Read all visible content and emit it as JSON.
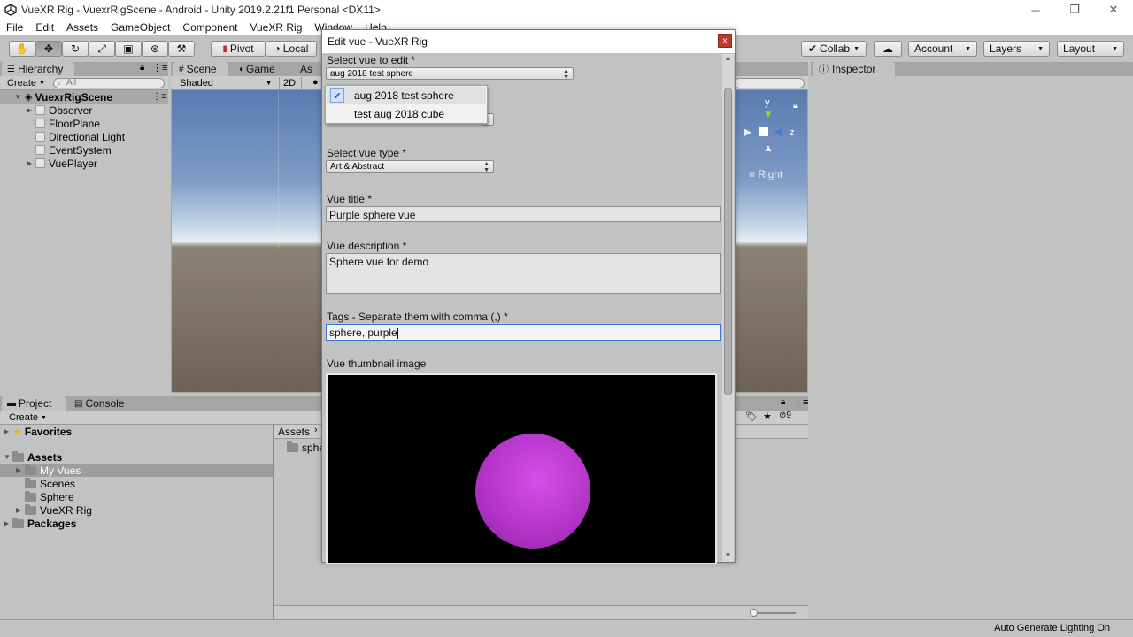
{
  "window": {
    "title": "VueXR Rig - VuexrRigScene - Android - Unity 2019.2.21f1 Personal <DX11>",
    "minimize": "─",
    "maximize": "❐",
    "close": "✕"
  },
  "menubar": [
    "File",
    "Edit",
    "Assets",
    "GameObject",
    "Component",
    "VueXR Rig",
    "Window",
    "Help"
  ],
  "toolbar": {
    "pivot": "Pivot",
    "local": "Local",
    "collab": "Collab",
    "account": "Account",
    "layers": "Layers",
    "layout": "Layout"
  },
  "hierarchy": {
    "tab": "Hierarchy",
    "create": "Create",
    "search_placeholder": "All",
    "scene": "VuexrRigScene",
    "items": [
      "Observer",
      "FloorPlane",
      "Directional Light",
      "EventSystem",
      "VuePlayer"
    ]
  },
  "scene": {
    "tab_scene": "Scene",
    "tab_game": "Game",
    "tab_asset": "As",
    "shaded": "Shaded",
    "mode_2d": "2D",
    "gizmo_y": "y",
    "gizmo_z": "z",
    "gizmo_view": "Right"
  },
  "inspector": {
    "tab": "Inspector"
  },
  "project": {
    "tab_project": "Project",
    "tab_console": "Console",
    "create": "Create",
    "favorites": "Favorites",
    "assets": "Assets",
    "asset_items": [
      "My Vues",
      "Scenes",
      "Sphere",
      "VueXR Rig"
    ],
    "packages": "Packages",
    "breadcrumb": "Assets",
    "file_partial": "sphe",
    "hidden_count": "9"
  },
  "dialog": {
    "title": "Edit vue - VueXR Rig",
    "close": "x",
    "select_label": "Select vue to edit *",
    "select_value": "aug 2018 test sphere",
    "type_label": "Select vue type *",
    "type_value": "Art & Abstract",
    "title_label": "Vue title *",
    "title_value": "Purple sphere vue",
    "desc_label": "Vue description *",
    "desc_value": "Sphere vue for demo",
    "tags_label": "Tags - Separate them with comma (,) *",
    "tags_value": "sphere, purple",
    "thumb_label": "Vue thumbnail image"
  },
  "dropdown": {
    "items": [
      "aug 2018 test sphere",
      "test aug 2018 cube"
    ],
    "selected_index": 0
  },
  "status": {
    "text": "Auto Generate Lighting On"
  },
  "colors": {
    "unity_grey": "#c2c2c2",
    "focus_blue": "#3b73d9",
    "sphere_purple": "#b535c9",
    "close_red": "#c0392b"
  }
}
